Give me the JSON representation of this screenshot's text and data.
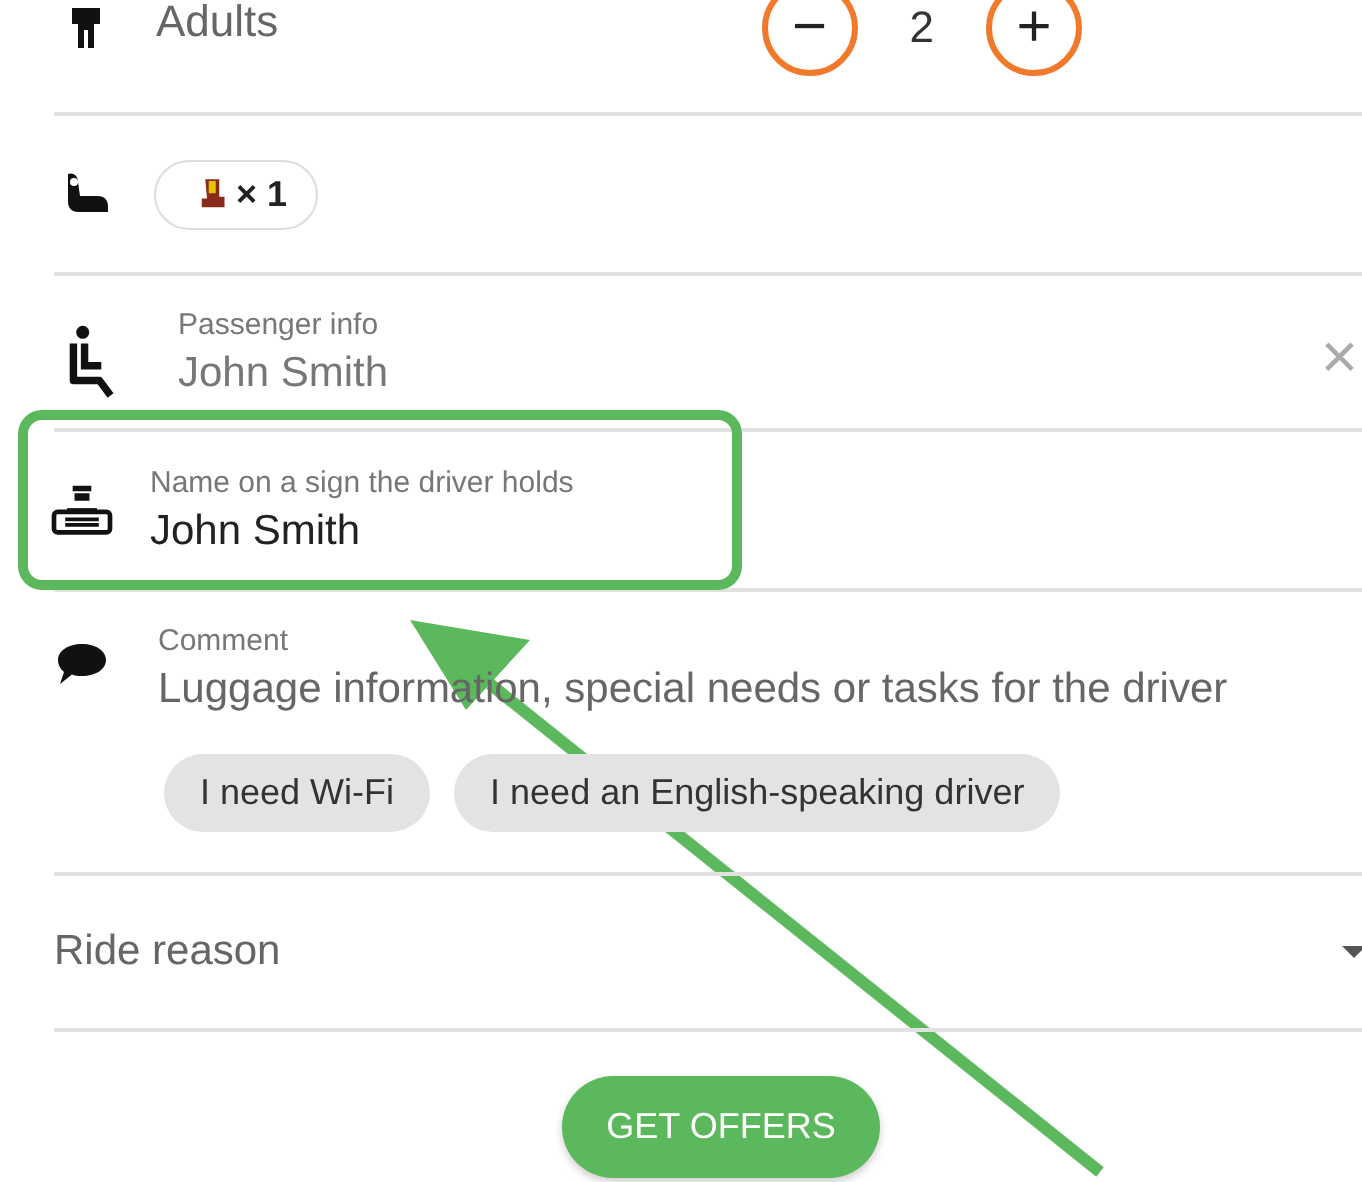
{
  "adults": {
    "label": "Adults",
    "count": "2",
    "minus": "−",
    "plus": "+"
  },
  "child_seat": {
    "count": "× 1"
  },
  "passenger": {
    "label": "Passenger info",
    "value": "John Smith",
    "clear": "×"
  },
  "sign": {
    "label": "Name on a sign the driver holds",
    "value": "John Smith",
    "highlighted": true
  },
  "comment": {
    "label": "Comment",
    "placeholder": "Luggage information, special needs or tasks for the driver"
  },
  "chips": [
    {
      "label": "I need Wi-Fi"
    },
    {
      "label": "I need an English-speaking driver"
    }
  ],
  "ride_reason": {
    "placeholder": "Ride reason"
  },
  "submit": "GET OFFERS"
}
